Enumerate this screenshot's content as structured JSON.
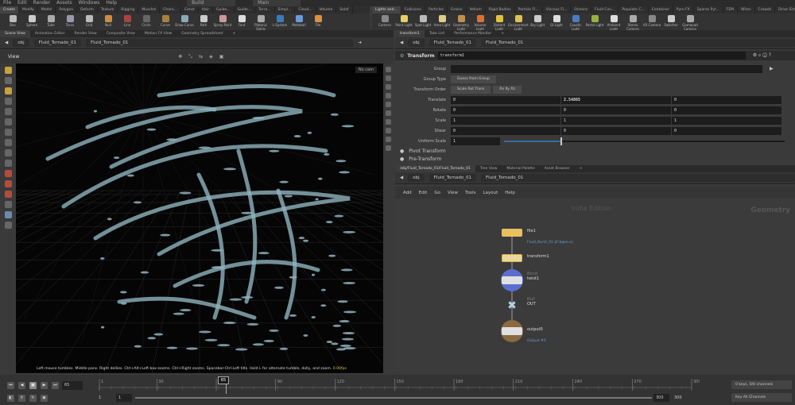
{
  "menu": [
    "File",
    "Edit",
    "Render",
    "Assets",
    "Windows",
    "Help"
  ],
  "desktop": {
    "left": "Build",
    "right": "Main"
  },
  "shelf_left": {
    "tabs": [
      "Create",
      "Modify",
      "Model",
      "Polygon",
      "Deform",
      "Texture",
      "Rigging",
      "Muscles",
      "Chara...",
      "Const",
      "Hair",
      "Guide...",
      "Guide...",
      "Terra...",
      "Simpl...",
      "Cloud...",
      "Volume",
      "Solaf"
    ],
    "tools": [
      "Box",
      "Sphere",
      "Tube",
      "Torus",
      "Grid",
      "Null",
      "Line",
      "Circle",
      "Curve",
      "Draw Curve",
      "Path",
      "Spray Paint",
      "Font",
      "Platonic Solids",
      "L-System",
      "Metaball",
      "File"
    ]
  },
  "shelf_right": {
    "tabs": [
      "Lights and...",
      "Collisions",
      "Particles",
      "Grains",
      "Vellum",
      "Rigid Bodies",
      "Particle Fl...",
      "Viscous Fl...",
      "Oceans",
      "Fluid Con...",
      "Populate C...",
      "Container",
      "Pyro FX",
      "Sparse Pyr...",
      "FEM",
      "Wires",
      "Crowds",
      "Drive Sim"
    ],
    "tools": [
      "Camera",
      "Point Light",
      "Spot Light",
      "Area Light",
      "Geometry Light",
      "Volume Light",
      "Distant Light",
      "Environment Light",
      "Sky Light",
      "GI Light",
      "Caustic Light",
      "Portal Light",
      "Ambient Light",
      "Stereo Camera",
      "VR Camera",
      "Switcher",
      "Gamepad Camera"
    ]
  },
  "left_pane": {
    "tabs": [
      "Scene View",
      "Animation Editor",
      "Render View",
      "Composite View",
      "Motion FX View",
      "Geometry Spreadsheet"
    ],
    "path": [
      "obj",
      "Fluid_Tornado_01",
      "Fluid_Tornado_01"
    ],
    "view_label": "View",
    "camera": "No cam",
    "status": "Left mouse tumbles. Middle pans. Right dollies. Ctrl+Alt+Left box-zooms. Ctrl+Right zooms. Spacebar-Ctrl-Left tilts. Hold L for alternate tumble, dolly, and zoom.",
    "status_fps": "0.00fps"
  },
  "param_pane": {
    "tabs": [
      "transform1",
      "Take List",
      "Performance Monitor"
    ],
    "path": [
      "obj",
      "Fluid_Tornado_01",
      "Fluid_Tornado_01"
    ],
    "node_type": "Transform",
    "node_name": "transform1",
    "group_label": "Group",
    "group_value": "",
    "group_type_label": "Group Type",
    "group_type": "Guess from Group",
    "order_label": "Transform Order",
    "order": "Scale Rot Trans",
    "rot_order": "Rx Ry Rz",
    "rows": [
      {
        "label": "Translate",
        "values": [
          "0",
          "2.54865",
          "0"
        ]
      },
      {
        "label": "Rotate",
        "values": [
          "0",
          "0",
          "0"
        ]
      },
      {
        "label": "Scale",
        "values": [
          "1",
          "1",
          "1"
        ]
      },
      {
        "label": "Shear",
        "values": [
          "0",
          "0",
          "0"
        ]
      }
    ],
    "uniform_label": "Uniform Scale",
    "uniform": "1",
    "uniform_slider": 0.2,
    "folders": [
      "Pivot Transform",
      "Pre-Transform"
    ]
  },
  "net_pane": {
    "tabs": [
      "/obj/Fluid_Tornado_01/Fluid_Tornado_01",
      "Tree View",
      "Material Palette",
      "Asset Browser"
    ],
    "path": [
      "obj",
      "Fluid_Tornado_01",
      "Fluid_Tornado_01"
    ],
    "menu": [
      "Add",
      "Edit",
      "Go",
      "View",
      "Tools",
      "Layout",
      "Help"
    ],
    "watermark": "Indie Edition",
    "context": "Geometry",
    "nodes": [
      {
        "name": "file1",
        "sub": "Fluid_Burst_01.$F.bgeo.sc",
        "type": ""
      },
      {
        "name": "transform1",
        "sub": "",
        "type": ""
      },
      {
        "name": "twist1",
        "sub": "",
        "type": "Bend"
      },
      {
        "name": "OUT",
        "sub": "",
        "type": "Null"
      },
      {
        "name": "output0",
        "sub": "Output #0",
        "type": ""
      }
    ]
  },
  "timeline": {
    "frame": "65",
    "ticks": [
      "1",
      "30",
      "60",
      "90",
      "120",
      "150",
      "180",
      "210",
      "240",
      "270",
      "300"
    ],
    "start": "1",
    "start2": "1",
    "end": "300",
    "end2": "300",
    "keys": "0 keys, 0/0 channels",
    "key_all": "Key All Channels"
  },
  "colors": {
    "accent": "#e0b040",
    "fluid": "#8fb3bd"
  }
}
